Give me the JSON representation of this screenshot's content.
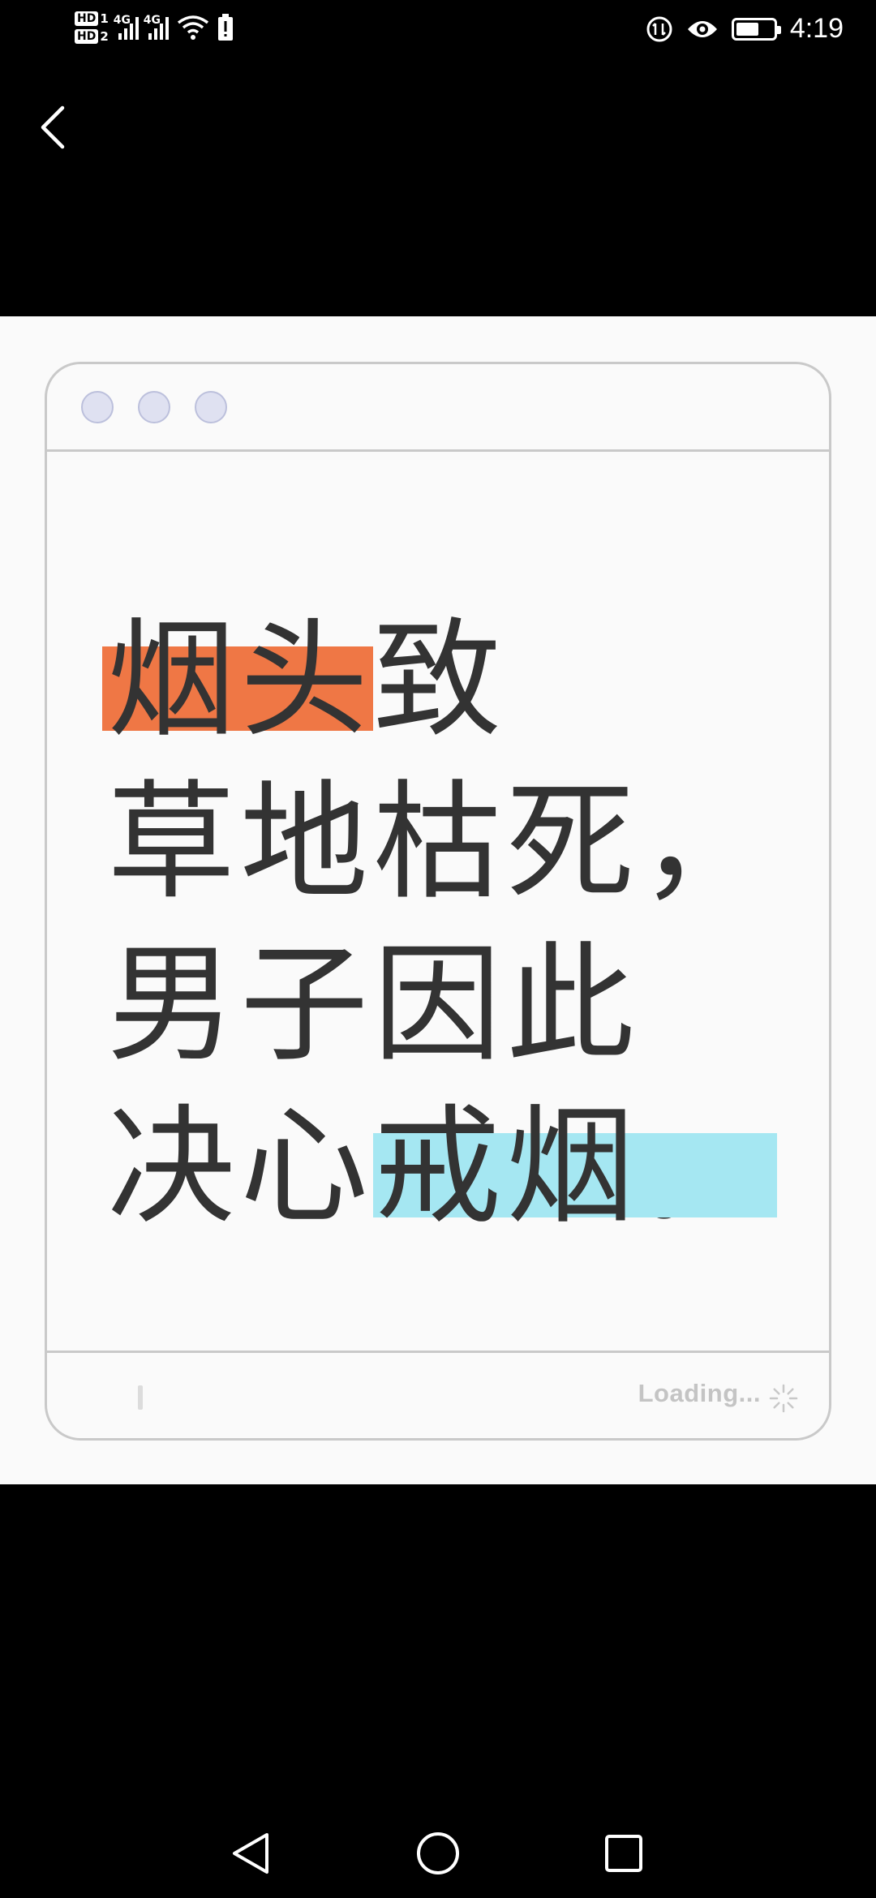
{
  "status_bar": {
    "hd1": "HD",
    "hd1_sub": "1",
    "hd2": "HD",
    "hd2_sub": "2",
    "net1": "4G",
    "net2": "4G",
    "time": "4:19"
  },
  "article_image": {
    "headline_lines": [
      [
        "烟头",
        "致"
      ],
      [
        "草地枯死，"
      ],
      [
        "男子因此"
      ],
      [
        "决心",
        "戒烟",
        "。"
      ]
    ],
    "highlight_colors": {
      "orange": "#ef7745",
      "cyan": "#a5e7f2"
    },
    "loading_text": "Loading..."
  },
  "icons": {
    "back": "chevron-left-icon",
    "nav_back": "triangle-back-icon",
    "nav_home": "circle-home-icon",
    "nav_recent": "square-recent-icon"
  }
}
